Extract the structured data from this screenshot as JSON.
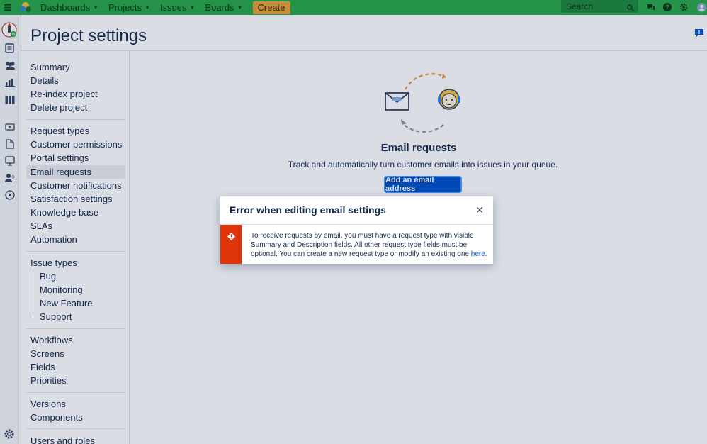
{
  "nav": {
    "items": [
      {
        "label": "Dashboards"
      },
      {
        "label": "Projects"
      },
      {
        "label": "Issues"
      },
      {
        "label": "Boards"
      }
    ],
    "create_label": "Create",
    "search_placeholder": "Search"
  },
  "page": {
    "title": "Project settings"
  },
  "sidebar": {
    "group1": [
      "Summary",
      "Details",
      "Re-index project",
      "Delete project"
    ],
    "group2": [
      "Request types",
      "Customer permissions",
      "Portal settings",
      "Email requests",
      "Customer notifications",
      "Satisfaction settings",
      "Knowledge base",
      "SLAs",
      "Automation"
    ],
    "group3_title": "Issue types",
    "group3_children": [
      "Bug",
      "Monitoring",
      "New Feature",
      "Support"
    ],
    "group4": [
      "Workflows",
      "Screens",
      "Fields",
      "Priorities"
    ],
    "group5": [
      "Versions",
      "Components"
    ],
    "group6": [
      "Users and roles"
    ],
    "active": "Email requests"
  },
  "main": {
    "heading": "Email requests",
    "description": "Track and automatically turn customer emails into issues in your queue.",
    "add_button_label": "Add an email address"
  },
  "dialog": {
    "title": "Error when editing email settings",
    "close_label": "✕",
    "message": "To receive requests by email, you must have a request type with visible Summary and Description fields. All other request type fields must be optional. You can create a new request type or modify an existing one ",
    "link_label": "here",
    "message_end": "."
  },
  "colors": {
    "topbar": "#2aa74a",
    "create": "#e9a43a",
    "primary": "#0052cc",
    "error": "#de350b"
  }
}
